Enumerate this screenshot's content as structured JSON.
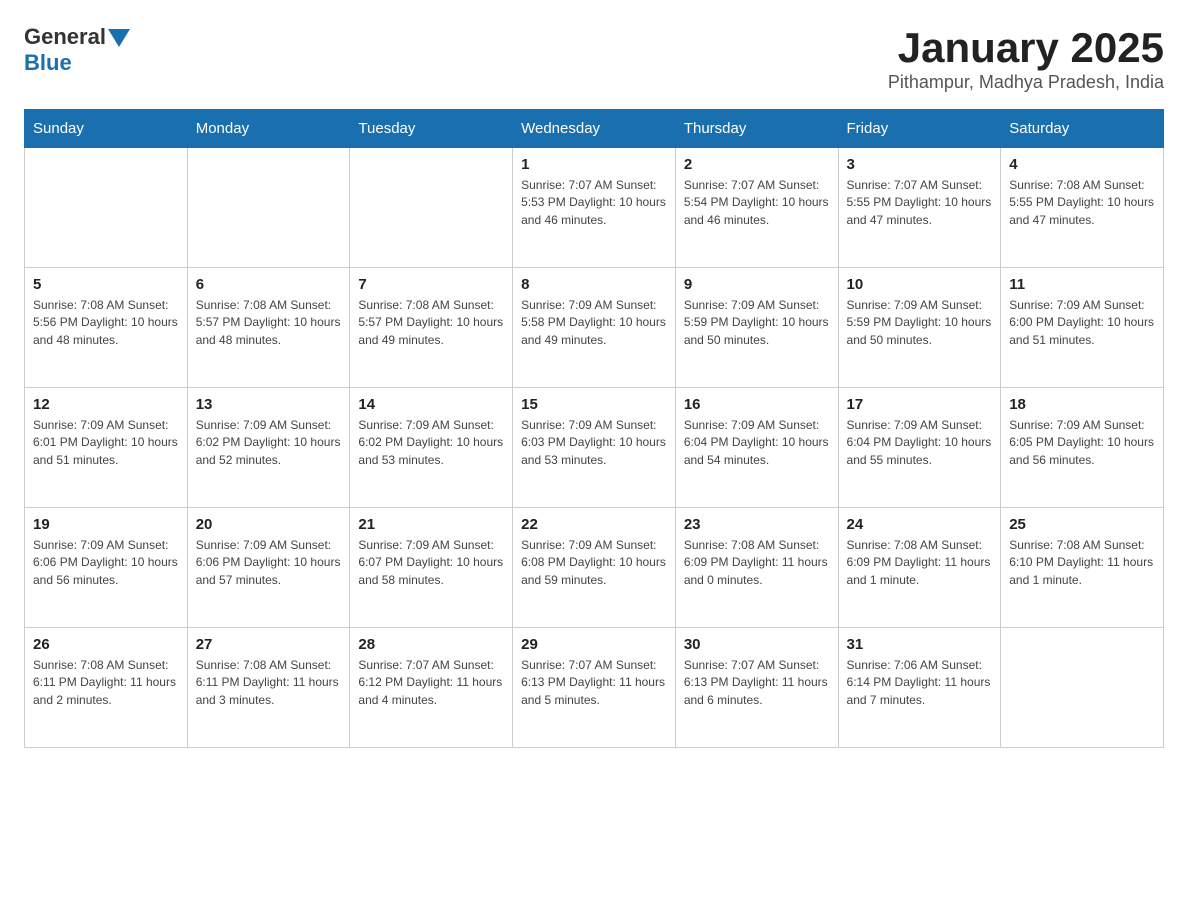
{
  "header": {
    "logo_general": "General",
    "logo_blue": "Blue",
    "month_title": "January 2025",
    "location": "Pithampur, Madhya Pradesh, India"
  },
  "days_of_week": [
    "Sunday",
    "Monday",
    "Tuesday",
    "Wednesday",
    "Thursday",
    "Friday",
    "Saturday"
  ],
  "weeks": [
    [
      {
        "day": "",
        "info": ""
      },
      {
        "day": "",
        "info": ""
      },
      {
        "day": "",
        "info": ""
      },
      {
        "day": "1",
        "info": "Sunrise: 7:07 AM\nSunset: 5:53 PM\nDaylight: 10 hours and 46 minutes."
      },
      {
        "day": "2",
        "info": "Sunrise: 7:07 AM\nSunset: 5:54 PM\nDaylight: 10 hours and 46 minutes."
      },
      {
        "day": "3",
        "info": "Sunrise: 7:07 AM\nSunset: 5:55 PM\nDaylight: 10 hours and 47 minutes."
      },
      {
        "day": "4",
        "info": "Sunrise: 7:08 AM\nSunset: 5:55 PM\nDaylight: 10 hours and 47 minutes."
      }
    ],
    [
      {
        "day": "5",
        "info": "Sunrise: 7:08 AM\nSunset: 5:56 PM\nDaylight: 10 hours and 48 minutes."
      },
      {
        "day": "6",
        "info": "Sunrise: 7:08 AM\nSunset: 5:57 PM\nDaylight: 10 hours and 48 minutes."
      },
      {
        "day": "7",
        "info": "Sunrise: 7:08 AM\nSunset: 5:57 PM\nDaylight: 10 hours and 49 minutes."
      },
      {
        "day": "8",
        "info": "Sunrise: 7:09 AM\nSunset: 5:58 PM\nDaylight: 10 hours and 49 minutes."
      },
      {
        "day": "9",
        "info": "Sunrise: 7:09 AM\nSunset: 5:59 PM\nDaylight: 10 hours and 50 minutes."
      },
      {
        "day": "10",
        "info": "Sunrise: 7:09 AM\nSunset: 5:59 PM\nDaylight: 10 hours and 50 minutes."
      },
      {
        "day": "11",
        "info": "Sunrise: 7:09 AM\nSunset: 6:00 PM\nDaylight: 10 hours and 51 minutes."
      }
    ],
    [
      {
        "day": "12",
        "info": "Sunrise: 7:09 AM\nSunset: 6:01 PM\nDaylight: 10 hours and 51 minutes."
      },
      {
        "day": "13",
        "info": "Sunrise: 7:09 AM\nSunset: 6:02 PM\nDaylight: 10 hours and 52 minutes."
      },
      {
        "day": "14",
        "info": "Sunrise: 7:09 AM\nSunset: 6:02 PM\nDaylight: 10 hours and 53 minutes."
      },
      {
        "day": "15",
        "info": "Sunrise: 7:09 AM\nSunset: 6:03 PM\nDaylight: 10 hours and 53 minutes."
      },
      {
        "day": "16",
        "info": "Sunrise: 7:09 AM\nSunset: 6:04 PM\nDaylight: 10 hours and 54 minutes."
      },
      {
        "day": "17",
        "info": "Sunrise: 7:09 AM\nSunset: 6:04 PM\nDaylight: 10 hours and 55 minutes."
      },
      {
        "day": "18",
        "info": "Sunrise: 7:09 AM\nSunset: 6:05 PM\nDaylight: 10 hours and 56 minutes."
      }
    ],
    [
      {
        "day": "19",
        "info": "Sunrise: 7:09 AM\nSunset: 6:06 PM\nDaylight: 10 hours and 56 minutes."
      },
      {
        "day": "20",
        "info": "Sunrise: 7:09 AM\nSunset: 6:06 PM\nDaylight: 10 hours and 57 minutes."
      },
      {
        "day": "21",
        "info": "Sunrise: 7:09 AM\nSunset: 6:07 PM\nDaylight: 10 hours and 58 minutes."
      },
      {
        "day": "22",
        "info": "Sunrise: 7:09 AM\nSunset: 6:08 PM\nDaylight: 10 hours and 59 minutes."
      },
      {
        "day": "23",
        "info": "Sunrise: 7:08 AM\nSunset: 6:09 PM\nDaylight: 11 hours and 0 minutes."
      },
      {
        "day": "24",
        "info": "Sunrise: 7:08 AM\nSunset: 6:09 PM\nDaylight: 11 hours and 1 minute."
      },
      {
        "day": "25",
        "info": "Sunrise: 7:08 AM\nSunset: 6:10 PM\nDaylight: 11 hours and 1 minute."
      }
    ],
    [
      {
        "day": "26",
        "info": "Sunrise: 7:08 AM\nSunset: 6:11 PM\nDaylight: 11 hours and 2 minutes."
      },
      {
        "day": "27",
        "info": "Sunrise: 7:08 AM\nSunset: 6:11 PM\nDaylight: 11 hours and 3 minutes."
      },
      {
        "day": "28",
        "info": "Sunrise: 7:07 AM\nSunset: 6:12 PM\nDaylight: 11 hours and 4 minutes."
      },
      {
        "day": "29",
        "info": "Sunrise: 7:07 AM\nSunset: 6:13 PM\nDaylight: 11 hours and 5 minutes."
      },
      {
        "day": "30",
        "info": "Sunrise: 7:07 AM\nSunset: 6:13 PM\nDaylight: 11 hours and 6 minutes."
      },
      {
        "day": "31",
        "info": "Sunrise: 7:06 AM\nSunset: 6:14 PM\nDaylight: 11 hours and 7 minutes."
      },
      {
        "day": "",
        "info": ""
      }
    ]
  ]
}
